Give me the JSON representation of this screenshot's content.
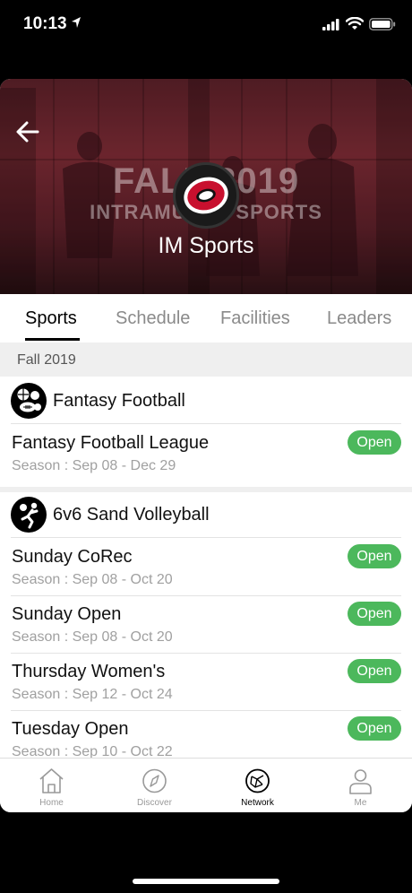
{
  "status_bar": {
    "time": "10:13",
    "icons": [
      "location-arrow-icon",
      "signal-icon",
      "wifi-icon",
      "battery-icon"
    ]
  },
  "hero": {
    "season_text": "FALL 2019",
    "subtitle_text": "INTRAMURAL SPORTS",
    "logo_letter": "O",
    "title": "IM Sports",
    "accent_color": "#7a2a34"
  },
  "tabs": [
    {
      "label": "Sports",
      "active": true
    },
    {
      "label": "Schedule",
      "active": false
    },
    {
      "label": "Facilities",
      "active": false
    },
    {
      "label": "Leaders",
      "active": false
    }
  ],
  "section": {
    "label": "Fall 2019"
  },
  "groups": [
    {
      "title": "Fantasy Football",
      "icon": "sports-balls-icon",
      "leagues": [
        {
          "name": "Fantasy Football League",
          "season": "Season : Sep 08 - Dec 29",
          "status": "Open"
        }
      ]
    },
    {
      "title": "6v6 Sand Volleyball",
      "icon": "volleyball-player-icon",
      "leagues": [
        {
          "name": "Sunday CoRec",
          "season": "Season : Sep 08 - Oct 20",
          "status": "Open"
        },
        {
          "name": "Sunday Open",
          "season": "Season : Sep 08 - Oct 20",
          "status": "Open"
        },
        {
          "name": "Thursday Women's",
          "season": "Season : Sep 12 - Oct 24",
          "status": "Open"
        },
        {
          "name": "Tuesday Open",
          "season": "Season : Sep 10 - Oct 22",
          "status": "Open"
        }
      ]
    }
  ],
  "bottom_nav": [
    {
      "label": "Home",
      "icon": "home-icon",
      "active": false
    },
    {
      "label": "Discover",
      "icon": "compass-icon",
      "active": false
    },
    {
      "label": "Network",
      "icon": "network-icon",
      "active": true
    },
    {
      "label": "Me",
      "icon": "person-icon",
      "active": false
    }
  ],
  "colors": {
    "open_badge": "#4cb85c",
    "tab_active": "#000000",
    "tab_inactive": "#8a8a8a"
  }
}
